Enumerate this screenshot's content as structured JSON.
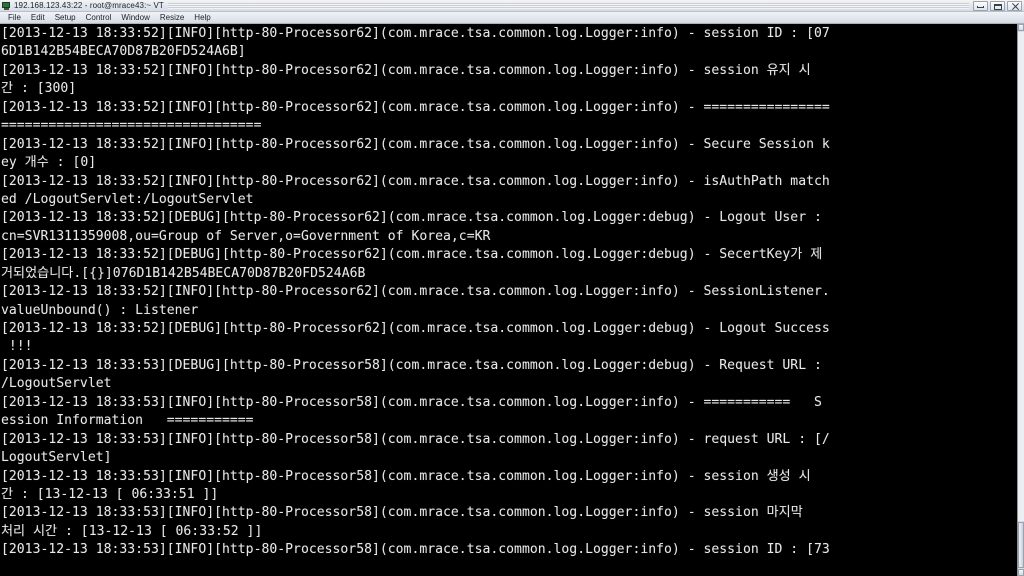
{
  "window": {
    "title": "192.168.123.43:22 - root@mrace43:~ VT",
    "icon": "terminal-monitor-icon",
    "buttons": {
      "minimize": "minimize-button",
      "maximize": "maximize-button",
      "close": "close-button"
    }
  },
  "menu": {
    "items": [
      {
        "label": "File"
      },
      {
        "label": "Edit"
      },
      {
        "label": "Setup"
      },
      {
        "label": "Control"
      },
      {
        "label": "Window"
      },
      {
        "label": "Resize"
      },
      {
        "label": "Help"
      }
    ]
  },
  "terminal": {
    "background_color": "#000000",
    "foreground_color": "#e9e9e9",
    "lines": [
      "[2013-12-13 18:33:52][INFO][http-80-Processor62](com.mrace.tsa.common.log.Logger:info) - session ID : [07",
      "6D1B142B54BECA70D87B20FD524A6B]",
      "[2013-12-13 18:33:52][INFO][http-80-Processor62](com.mrace.tsa.common.log.Logger:info) - session 유지 시",
      "간 : [300]",
      "[2013-12-13 18:33:52][INFO][http-80-Processor62](com.mrace.tsa.common.log.Logger:info) - ================",
      "=================================",
      "[2013-12-13 18:33:52][INFO][http-80-Processor62](com.mrace.tsa.common.log.Logger:info) - Secure Session k",
      "ey 개수 : [0]",
      "[2013-12-13 18:33:52][INFO][http-80-Processor62](com.mrace.tsa.common.log.Logger:info) - isAuthPath match",
      "ed /LogoutServlet:/LogoutServlet",
      "[2013-12-13 18:33:52][DEBUG][http-80-Processor62](com.mrace.tsa.common.log.Logger:debug) - Logout User :",
      "cn=SVR1311359008,ou=Group of Server,o=Government of Korea,c=KR",
      "[2013-12-13 18:33:52][DEBUG][http-80-Processor62](com.mrace.tsa.common.log.Logger:debug) - SecertKey가 제",
      "거되었습니다.[{}]076D1B142B54BECA70D87B20FD524A6B",
      "[2013-12-13 18:33:52][INFO][http-80-Processor62](com.mrace.tsa.common.log.Logger:info) - SessionListener.",
      "valueUnbound() : Listener",
      "[2013-12-13 18:33:52][DEBUG][http-80-Processor62](com.mrace.tsa.common.log.Logger:debug) - Logout Success",
      " !!!",
      "[2013-12-13 18:33:53][DEBUG][http-80-Processor58](com.mrace.tsa.common.log.Logger:debug) - Request URL :",
      "/LogoutServlet",
      "[2013-12-13 18:33:53][INFO][http-80-Processor58](com.mrace.tsa.common.log.Logger:info) - ===========   S",
      "ession Information   ===========",
      "[2013-12-13 18:33:53][INFO][http-80-Processor58](com.mrace.tsa.common.log.Logger:info) - request URL : [/",
      "LogoutServlet]",
      "[2013-12-13 18:33:53][INFO][http-80-Processor58](com.mrace.tsa.common.log.Logger:info) - session 생성 시",
      "간 : [13-12-13 [ 06:33:51 ]]",
      "[2013-12-13 18:33:53][INFO][http-80-Processor58](com.mrace.tsa.common.log.Logger:info) - session 마지막",
      "처리 시간 : [13-12-13 [ 06:33:52 ]]",
      "[2013-12-13 18:33:53][INFO][http-80-Processor58](com.mrace.tsa.common.log.Logger:info) - session ID : [73"
    ]
  }
}
